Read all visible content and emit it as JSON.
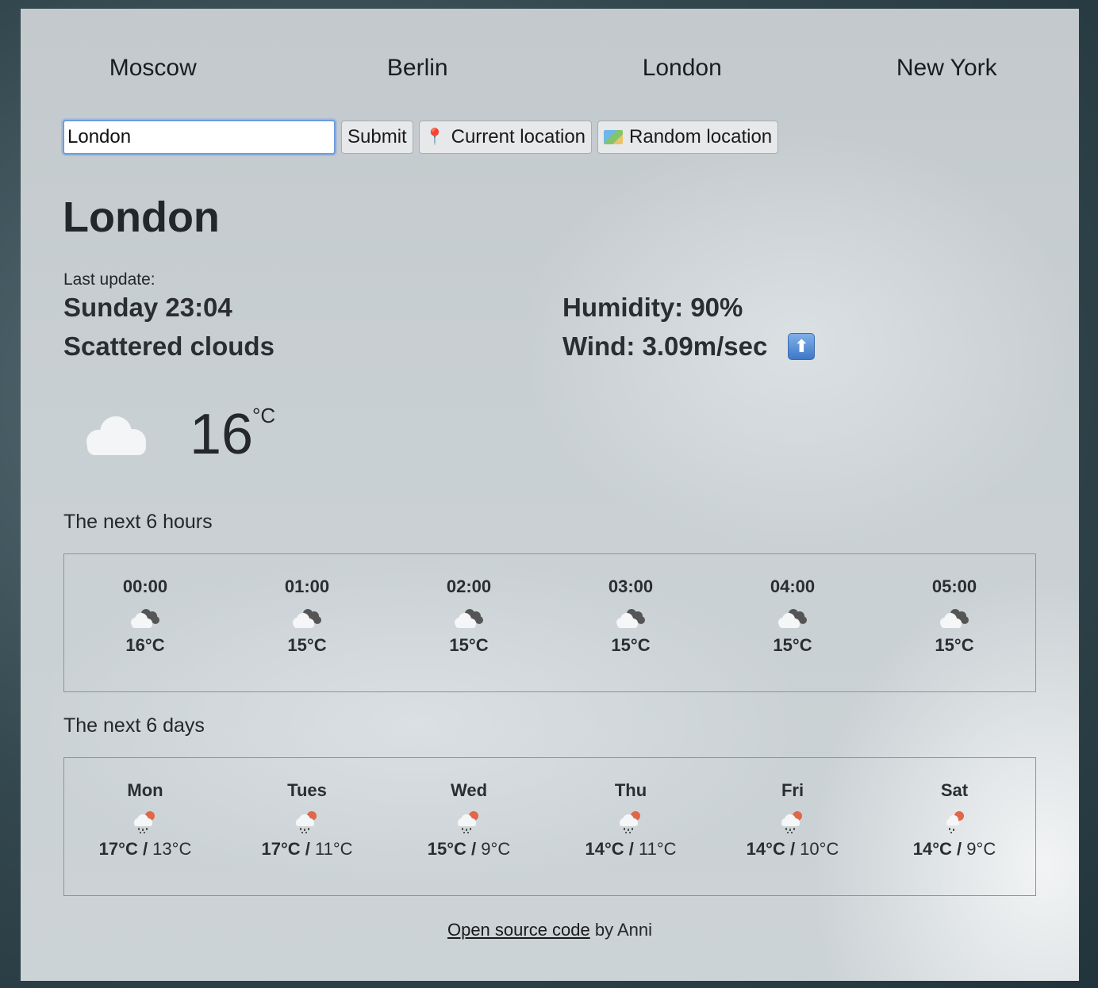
{
  "nav": {
    "cities": [
      "Moscow",
      "Berlin",
      "London",
      "New York"
    ]
  },
  "search": {
    "value": "London",
    "submit_label": "Submit",
    "current_label": "Current location",
    "random_label": "Random location"
  },
  "weather": {
    "city": "London",
    "last_update_label": "Last update:",
    "day_time": "Sunday 23:04",
    "description": "Scattered clouds",
    "humidity": "Humidity: 90%",
    "wind": "Wind: 3.09m/sec",
    "wind_icon": "up-arrow-icon",
    "temperature": "16",
    "unit": "°C",
    "icon": "cloud-icon"
  },
  "hourly": {
    "title": "The next 6 hours",
    "items": [
      {
        "time": "00:00",
        "temp": "16°C",
        "icon": "cloudy-night-icon"
      },
      {
        "time": "01:00",
        "temp": "15°C",
        "icon": "cloudy-night-icon"
      },
      {
        "time": "02:00",
        "temp": "15°C",
        "icon": "cloudy-night-icon"
      },
      {
        "time": "03:00",
        "temp": "15°C",
        "icon": "cloudy-night-icon"
      },
      {
        "time": "04:00",
        "temp": "15°C",
        "icon": "cloudy-night-icon"
      },
      {
        "time": "05:00",
        "temp": "15°C",
        "icon": "cloudy-night-icon"
      }
    ]
  },
  "daily": {
    "title": "The next 6 days",
    "items": [
      {
        "day": "Mon",
        "high": "17°C",
        "low": "13°C",
        "icon": "rain-sun-icon"
      },
      {
        "day": "Tues",
        "high": "17°C",
        "low": "11°C",
        "icon": "rain-sun-icon"
      },
      {
        "day": "Wed",
        "high": "15°C",
        "low": "9°C",
        "icon": "rain-sun-icon"
      },
      {
        "day": "Thu",
        "high": "14°C",
        "low": "11°C",
        "icon": "rain-sun-icon"
      },
      {
        "day": "Fri",
        "high": "14°C",
        "low": "10°C",
        "icon": "rain-sun-icon"
      },
      {
        "day": "Sat",
        "high": "14°C",
        "low": "9°C",
        "icon": "light-rain-sun-icon"
      }
    ]
  },
  "footer": {
    "link_text": "Open source code",
    "suffix": " by Anni"
  }
}
